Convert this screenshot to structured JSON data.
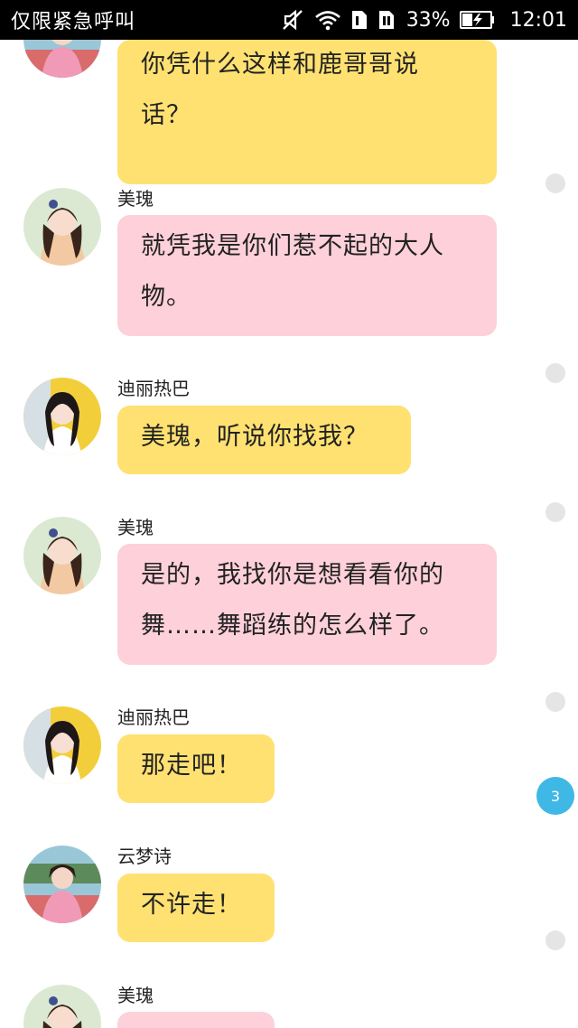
{
  "status_bar": {
    "carrier": "仅限紧急呼叫",
    "battery": "33%",
    "time": "12:01",
    "icons": [
      "mute-icon",
      "wifi-icon",
      "sim1-icon",
      "sim2-icon",
      "battery-charging-icon"
    ]
  },
  "messages": [
    {
      "sender": "",
      "avatar": "yunmengshi-avatar",
      "color": "#ffe171",
      "lines": [
        "你凭什么这样和鹿哥哥说",
        "话？"
      ]
    },
    {
      "sender": "美瑰",
      "avatar": "meigui-avatar",
      "color": "#fdd0da",
      "lines": [
        "就凭我是你们惹不起的大人",
        "物。"
      ]
    },
    {
      "sender": "迪丽热巴",
      "avatar": "dilireba-avatar",
      "color": "#ffe171",
      "lines": [
        "美瑰，听说你找我？"
      ]
    },
    {
      "sender": "美瑰",
      "avatar": "meigui-avatar",
      "color": "#fdd0da",
      "lines": [
        "是的，我找你是想看看你的",
        "舞……舞蹈练的怎么样了。"
      ]
    },
    {
      "sender": "迪丽热巴",
      "avatar": "dilireba-avatar",
      "color": "#ffe171",
      "lines": [
        "那走吧！"
      ]
    },
    {
      "sender": "云梦诗",
      "avatar": "yunmengshi-avatar",
      "color": "#ffe171",
      "lines": [
        "不许走！"
      ]
    },
    {
      "sender": "美瑰",
      "avatar": "meigui-avatar",
      "color": "#fdd0da",
      "lines": [
        ""
      ]
    }
  ],
  "unread_badge": "3"
}
